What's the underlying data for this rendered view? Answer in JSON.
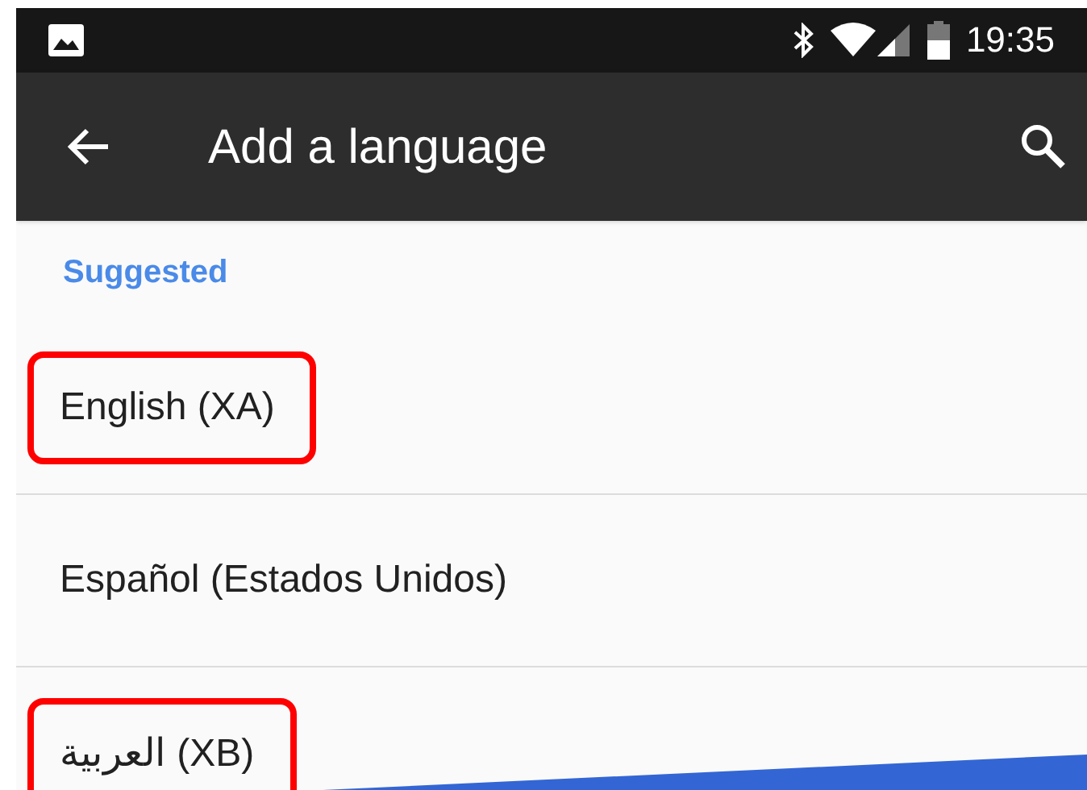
{
  "status_bar": {
    "time": "19:35"
  },
  "app_bar": {
    "title": "Add a language"
  },
  "section": {
    "header": "Suggested"
  },
  "languages": [
    {
      "name": "English (XA)",
      "highlighted": true
    },
    {
      "name": "Español (Estados Unidos)",
      "highlighted": false
    },
    {
      "name": "العربية (XB)",
      "highlighted": true
    }
  ]
}
